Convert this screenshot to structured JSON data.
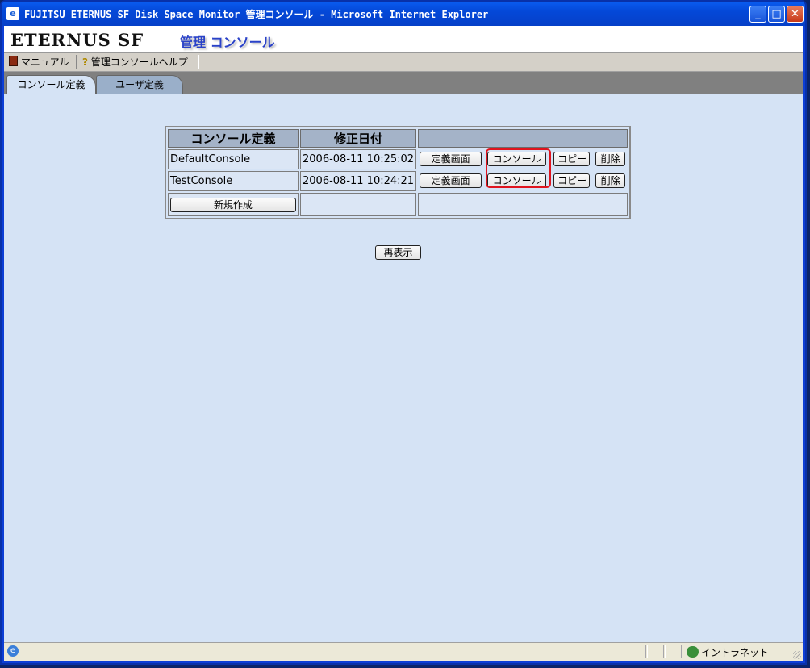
{
  "window": {
    "title": "FUJITSU ETERNUS SF Disk Space Monitor 管理コンソール - Microsoft Internet Explorer",
    "icon": "ie-icon",
    "controls": {
      "minimize": "_",
      "maximize": "□",
      "close": "✕"
    }
  },
  "header": {
    "logo": "ETERNUS SF",
    "title": "管理 コンソール"
  },
  "menu": {
    "items": [
      {
        "label": "マニュアル",
        "icon": "book-icon"
      },
      {
        "label": "管理コンソールヘルプ",
        "icon": "help-icon"
      }
    ]
  },
  "tabs": [
    {
      "label": "コンソール定義",
      "active": true
    },
    {
      "label": "ユーザ定義",
      "active": false
    }
  ],
  "table": {
    "headers": [
      "コンソール定義",
      "修正日付",
      ""
    ],
    "rows": [
      {
        "name": "DefaultConsole",
        "date": "2006-08-11 10:25:02"
      },
      {
        "name": "TestConsole",
        "date": "2006-08-11 10:24:21"
      }
    ],
    "row_buttons": {
      "define_screen": "定義画面",
      "console": "コンソール",
      "copy": "コピー",
      "delete": "削除"
    },
    "new_button": "新規作成"
  },
  "refresh_button": "再表示",
  "status": {
    "zone": "イントラネット"
  },
  "colors": {
    "page_bg": "#d5e3f5",
    "titlebar": "#0a5cf0",
    "highlight": "#e0141e",
    "header_title": "#2a42c8"
  }
}
